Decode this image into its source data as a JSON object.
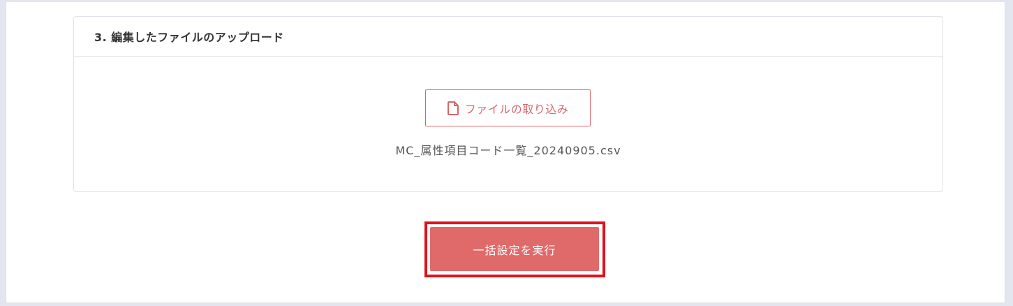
{
  "section": {
    "title": "3. 編集したファイルのアップロード",
    "import_button_label": "ファイルの取り込み",
    "file_name": "MC_属性項目コード一覧_20240905.csv"
  },
  "actions": {
    "execute_label": "一括設定を実行"
  },
  "icons": {
    "import": "file-icon"
  },
  "colors": {
    "accent": "#d9666a",
    "execute_button": "#e06a6a",
    "highlight": "#e0121c"
  }
}
